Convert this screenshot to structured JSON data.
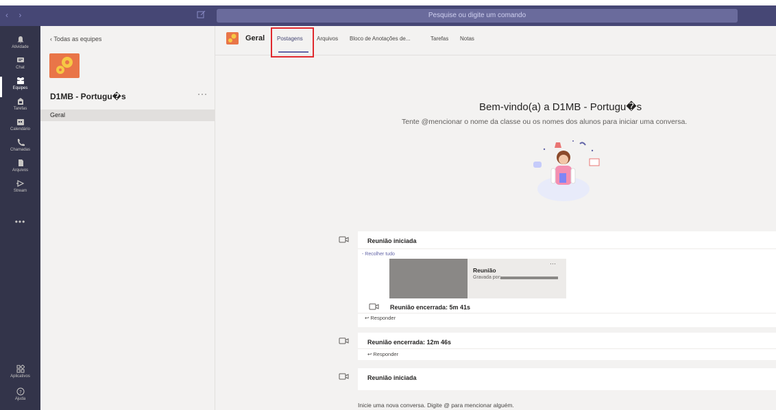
{
  "titlebar": {
    "nav_arrows": "‹ ›",
    "search_placeholder": "Pesquise ou digite um comando"
  },
  "rail": {
    "items": [
      {
        "label": "Atividade",
        "icon": "bell-icon"
      },
      {
        "label": "Chat",
        "icon": "chat-icon"
      },
      {
        "label": "Equipes",
        "icon": "teams-icon",
        "active": true
      },
      {
        "label": "Tarefas",
        "icon": "assignments-icon"
      },
      {
        "label": "Calendário",
        "icon": "calendar-icon"
      },
      {
        "label": "Chamadas",
        "icon": "phone-icon"
      },
      {
        "label": "Arquivos",
        "icon": "file-icon"
      },
      {
        "label": "Stream",
        "icon": "stream-icon"
      }
    ],
    "more": "•••",
    "bottom_items": [
      {
        "label": "Aplicativos",
        "icon": "apps-icon"
      },
      {
        "label": "Ajuda",
        "icon": "help-icon"
      }
    ]
  },
  "team_panel": {
    "back_label": "Todas as equipes",
    "team_name": "D1MB - Portugu�s",
    "more": "···",
    "channels": [
      "Geral"
    ]
  },
  "header": {
    "channel": "Geral",
    "tabs": [
      "Postagens",
      "Arquivos",
      "Bloco de Anotações de...",
      "Tarefas",
      "Notas"
    ],
    "active_tab": "Postagens"
  },
  "welcome": {
    "title": "Bem-vindo(a) a D1MB - Portugu�s",
    "subtitle": "Tente @mencionar o nome da classe ou os nomes dos alunos para iniciar uma conversa."
  },
  "posts": [
    {
      "title": "Reunião iniciada",
      "collapse": "- Recolher tudo",
      "recording": {
        "title": "Reunião",
        "by": "Gravada por:",
        "more": "···"
      },
      "ended": "Reunião encerrada: 5m 41s",
      "reply": "Responder"
    },
    {
      "title": "Reunião encerrada: 12m 46s",
      "reply": "Responder"
    },
    {
      "title": "Reunião iniciada"
    }
  ],
  "compose": {
    "placeholder": "Inicie uma nova conversa. Digite @ para mencionar alguém."
  },
  "colors": {
    "titlebar": "#464775",
    "rail": "#33344a",
    "accent": "#6264a7",
    "team_orange": "#e97548",
    "highlight_red": "#e0282d"
  }
}
